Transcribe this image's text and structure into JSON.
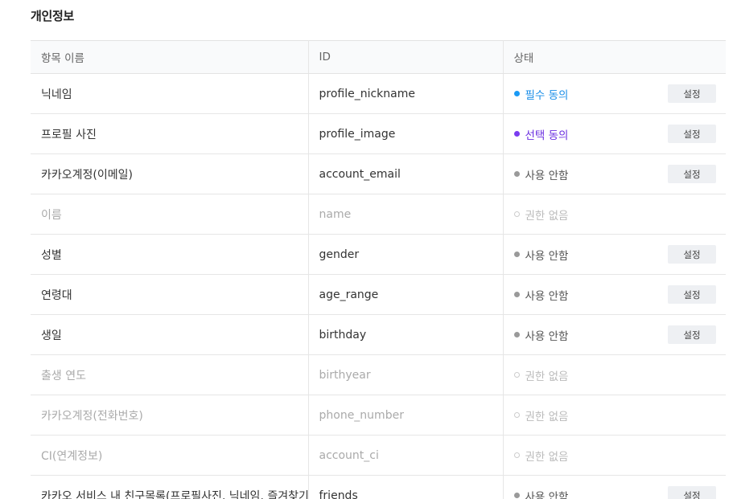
{
  "section": {
    "title": "개인정보"
  },
  "table": {
    "headers": {
      "name": "항목 이름",
      "id": "ID",
      "state": "상태"
    },
    "rows": [
      {
        "name": "닉네임",
        "id": "profile_nickname",
        "state": "필수 동의",
        "status": "required",
        "button": "설정"
      },
      {
        "name": "프로필 사진",
        "id": "profile_image",
        "state": "선택 동의",
        "status": "optional",
        "button": "설정"
      },
      {
        "name": "카카오계정(이메일)",
        "id": "account_email",
        "state": "사용 안함",
        "status": "unused",
        "button": "설정"
      },
      {
        "name": "이름",
        "id": "name",
        "state": "권한 없음",
        "status": "none",
        "button": null
      },
      {
        "name": "성별",
        "id": "gender",
        "state": "사용 안함",
        "status": "unused",
        "button": "설정"
      },
      {
        "name": "연령대",
        "id": "age_range",
        "state": "사용 안함",
        "status": "unused",
        "button": "설정"
      },
      {
        "name": "생일",
        "id": "birthday",
        "state": "사용 안함",
        "status": "unused",
        "button": "설정"
      },
      {
        "name": "출생 연도",
        "id": "birthyear",
        "state": "권한 없음",
        "status": "none",
        "button": null
      },
      {
        "name": "카카오계정(전화번호)",
        "id": "phone_number",
        "state": "권한 없음",
        "status": "none",
        "button": null
      },
      {
        "name": "CI(연계정보)",
        "id": "account_ci",
        "state": "권한 없음",
        "status": "none",
        "button": null
      },
      {
        "name": "카카오 서비스 내 친구목록(프로필사진, 닉네임, 즐겨찾기",
        "id": "friends",
        "state": "사용 안함",
        "status": "unused",
        "button": "설정"
      }
    ]
  },
  "colors": {
    "required": "#1a9af5",
    "optional": "#7a3cf0",
    "unused": "#9a9a9a",
    "none": "#cccccc"
  }
}
